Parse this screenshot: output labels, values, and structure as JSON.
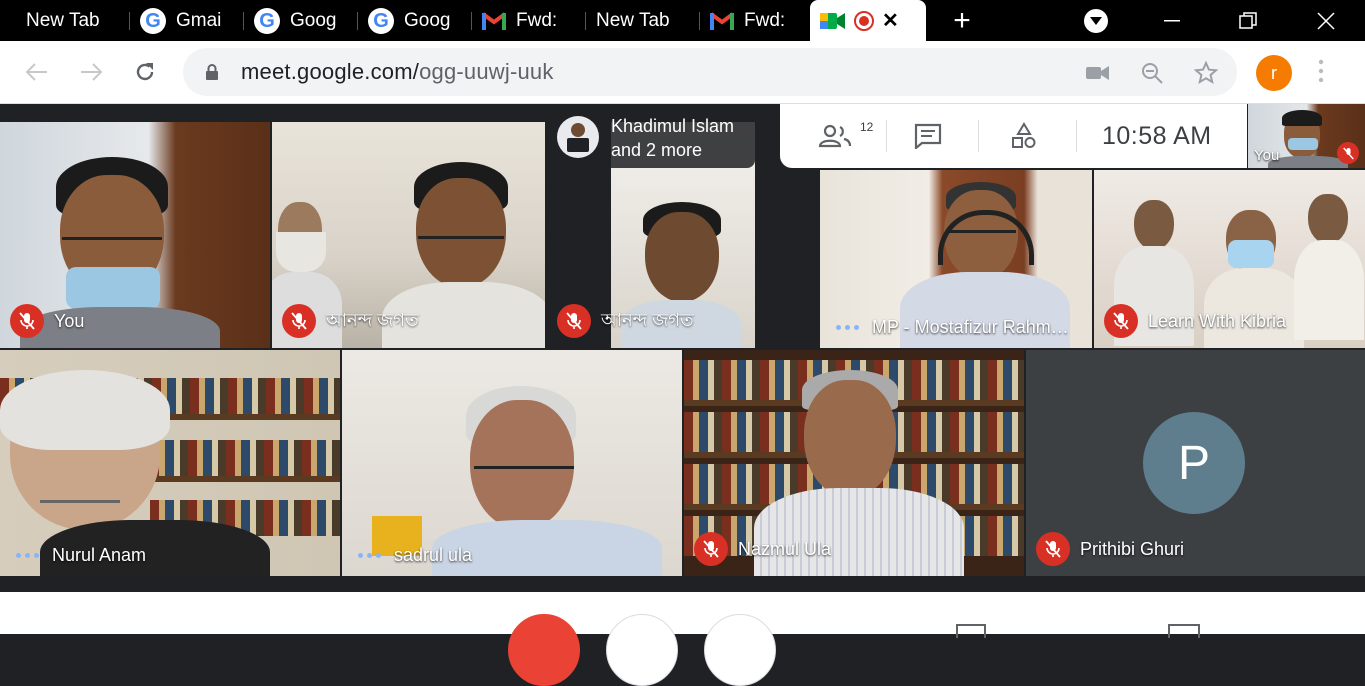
{
  "tabs": [
    {
      "label": "New Tab",
      "icon": "none"
    },
    {
      "label": "Gmai",
      "icon": "google-icon"
    },
    {
      "label": "Goog",
      "icon": "google-icon"
    },
    {
      "label": "Goog",
      "icon": "google-icon"
    },
    {
      "label": "Fwd:",
      "icon": "gmail-icon"
    },
    {
      "label": "New Tab",
      "icon": "none"
    },
    {
      "label": "Fwd:",
      "icon": "gmail-icon"
    },
    {
      "label": "",
      "icon": "meet-icon"
    }
  ],
  "browser": {
    "url_host": "meet.google.com/",
    "url_path": "ogg-uuwj-uuk",
    "profile_initial": "r",
    "new_tab": "+",
    "close_tab": "✕"
  },
  "meet": {
    "presenter": {
      "name_line1": "Khadimul Islam",
      "name_line2": "and 2 more"
    },
    "participant_count": "12",
    "time": "10:58  AM",
    "self_label": "You",
    "tiles": [
      {
        "name": "You",
        "status": "muted"
      },
      {
        "name": "আনন্দ জগত",
        "status": "muted"
      },
      {
        "name": "আনন্দ জগত",
        "status": "muted"
      },
      {
        "name": "MP - Mostafizur Rahm…",
        "status": "speaking"
      },
      {
        "name": "Learn With Kibria",
        "status": "muted"
      },
      {
        "name": "Nurul Anam",
        "status": "speaking"
      },
      {
        "name": "sadrul ula",
        "status": "speaking"
      },
      {
        "name": "Nazmul Ula",
        "status": "muted"
      },
      {
        "name": "Prithibi Ghuri",
        "status": "muted"
      }
    ],
    "avatar_initial": "P"
  },
  "colors": {
    "red": "#d93025",
    "meet_bg": "#202124",
    "profile": "#f57c00",
    "avatar": "#5f7e8d"
  }
}
